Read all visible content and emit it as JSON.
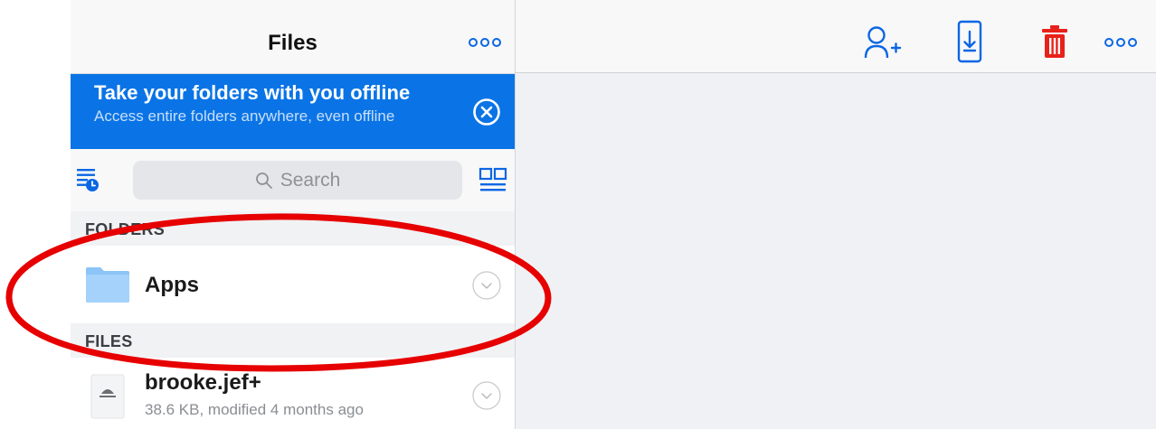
{
  "sidebar": {
    "title": "Files",
    "more_icon": "ellipsis-icon",
    "banner": {
      "title": "Take your folders with you offline",
      "subtitle": "Access entire folders anywhere, even offline",
      "close_icon": "close-circle-icon"
    },
    "search": {
      "label": "Search",
      "icon": "search-icon"
    },
    "left_tool_icon": "recents-icon",
    "right_tool_icon": "grid-view-icon",
    "folders_header": "FOLDERS",
    "folders": [
      {
        "name": "Apps",
        "icon": "folder-icon",
        "action_icon": "chevron-down-circle-icon"
      }
    ],
    "files_header": "FILES",
    "files": [
      {
        "name": "brooke.jef+",
        "meta": "38.6 KB, modified 4 months ago",
        "icon": "file-icon",
        "action_icon": "chevron-down-circle-icon"
      }
    ]
  },
  "toolbar": {
    "share_icon": "add-person-icon",
    "download_icon": "save-to-device-icon",
    "delete_icon": "trash-icon",
    "more_icon": "ellipsis-icon"
  },
  "colors": {
    "accent": "#0a74e6",
    "delete": "#e8211b",
    "annotation": "#e60000"
  }
}
